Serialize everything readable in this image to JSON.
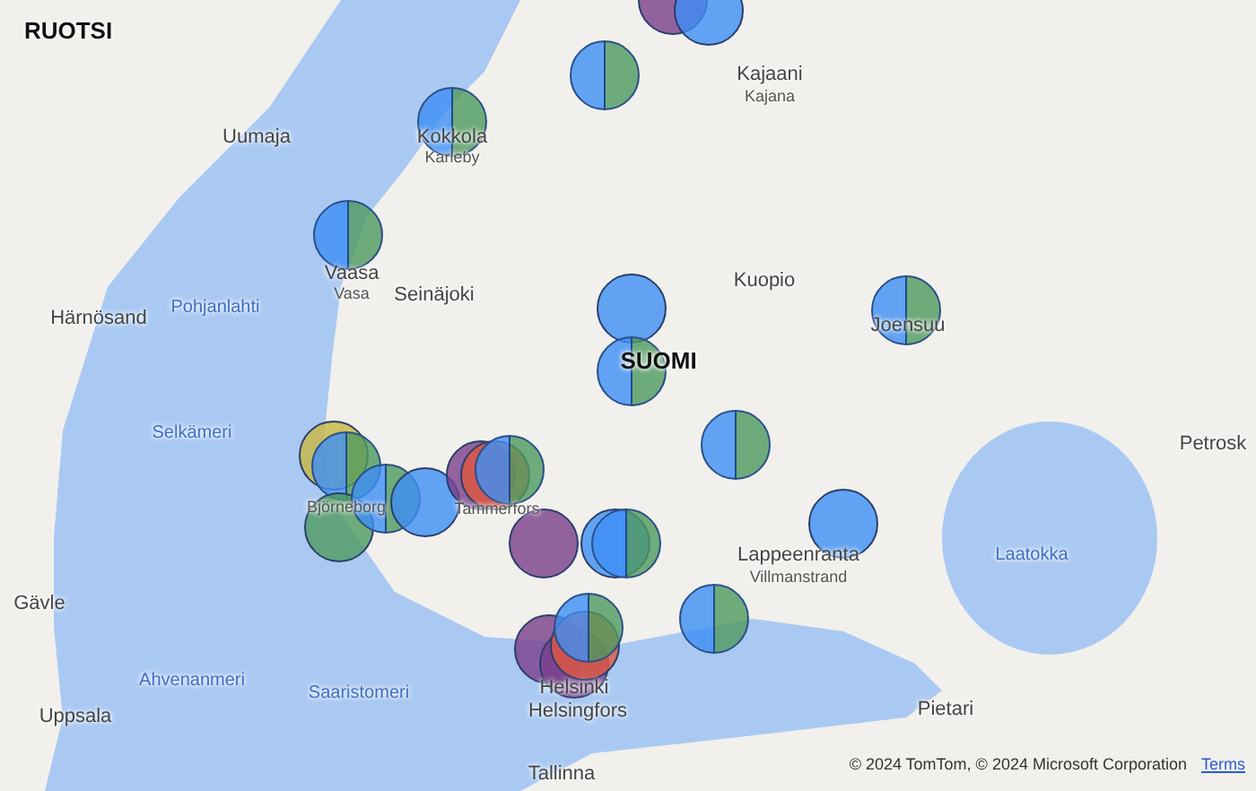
{
  "map": {
    "labels": [
      {
        "text": "RUOTSI",
        "kind": "country"
      },
      {
        "text": "Uumaja",
        "kind": "city"
      },
      {
        "text": "Kajaani",
        "kind": "city"
      },
      {
        "text": "Kajana",
        "kind": "alt"
      },
      {
        "text": "Kokkola",
        "kind": "city"
      },
      {
        "text": "Karleby",
        "kind": "alt"
      },
      {
        "text": "Vaasa",
        "kind": "city"
      },
      {
        "text": "Vasa",
        "kind": "alt"
      },
      {
        "text": "Seinäjoki",
        "kind": "city"
      },
      {
        "text": "Härnösand",
        "kind": "city"
      },
      {
        "text": "Pohjanlahti",
        "kind": "water"
      },
      {
        "text": "Kuopio",
        "kind": "city"
      },
      {
        "text": "Joensuu",
        "kind": "city"
      },
      {
        "text": "SUOMI",
        "kind": "country"
      },
      {
        "text": "Selkämeri",
        "kind": "water"
      },
      {
        "text": "Björneborg",
        "kind": "alt"
      },
      {
        "text": "Tammerfors",
        "kind": "alt"
      },
      {
        "text": "Petrosk",
        "kind": "city"
      },
      {
        "text": "Laatokka",
        "kind": "water"
      },
      {
        "text": "Lappeenranta",
        "kind": "city"
      },
      {
        "text": "Villmanstrand",
        "kind": "alt"
      },
      {
        "text": "Gävle",
        "kind": "city"
      },
      {
        "text": "Ahvenanmeri",
        "kind": "water"
      },
      {
        "text": "Saaristomeri",
        "kind": "water"
      },
      {
        "text": "Uppsala",
        "kind": "city"
      },
      {
        "text": "Helsinki",
        "kind": "city"
      },
      {
        "text": "Helsingfors",
        "kind": "city"
      },
      {
        "text": "Pietari",
        "kind": "city"
      },
      {
        "text": "Tallinna",
        "kind": "city"
      }
    ]
  },
  "attribution": {
    "text": "© 2024 TomTom, © 2024 Microsoft Corporation",
    "link": "Terms"
  }
}
